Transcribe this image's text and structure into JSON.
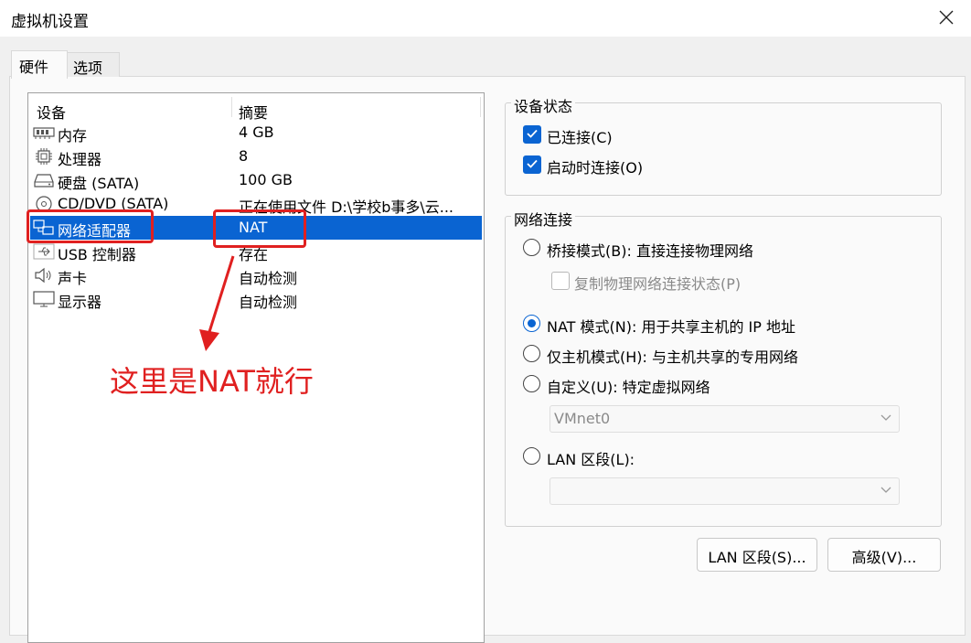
{
  "window": {
    "title": "虚拟机设置"
  },
  "tabs": [
    {
      "label": "硬件"
    },
    {
      "label": "选项"
    }
  ],
  "device_list": {
    "columns": {
      "device": "设备",
      "summary": "摘要"
    },
    "rows": [
      {
        "name": "内存",
        "summary": "4 GB",
        "icon": "memory-icon"
      },
      {
        "name": "处理器",
        "summary": "8",
        "icon": "processor-icon"
      },
      {
        "name": "硬盘 (SATA)",
        "summary": "100 GB",
        "icon": "harddisk-icon"
      },
      {
        "name": "CD/DVD (SATA)",
        "summary": "正在使用文件 D:\\学校b事多\\云...",
        "icon": "cd-dvd-icon"
      },
      {
        "name": "网络适配器",
        "summary": "NAT",
        "icon": "network-adapter-icon",
        "selected": true
      },
      {
        "name": "USB 控制器",
        "summary": "存在",
        "icon": "usb-icon"
      },
      {
        "name": "声卡",
        "summary": "自动检测",
        "icon": "speaker-icon"
      },
      {
        "name": "显示器",
        "summary": "自动检测",
        "icon": "monitor-icon"
      }
    ]
  },
  "annotation": {
    "text": "这里是NAT就行",
    "color": "#e02020"
  },
  "device_status": {
    "title": "设备状态",
    "connected": {
      "label": "已连接(C)",
      "checked": true
    },
    "connect_at_power_on": {
      "label": "启动时连接(O)",
      "checked": true
    }
  },
  "network_connection": {
    "title": "网络连接",
    "bridged": {
      "label": "桥接模式(B): 直接连接物理网络",
      "selected": false
    },
    "replicate": {
      "label": "复制物理网络连接状态(P)",
      "checked": false,
      "disabled": true
    },
    "nat": {
      "label": "NAT 模式(N): 用于共享主机的 IP 地址",
      "selected": true
    },
    "host_only": {
      "label": "仅主机模式(H): 与主机共享的专用网络",
      "selected": false
    },
    "custom": {
      "label": "自定义(U): 特定虚拟网络",
      "selected": false
    },
    "custom_select": {
      "value": "VMnet0"
    },
    "lan_segment": {
      "label": "LAN 区段(L):",
      "selected": false
    },
    "lan_select": {
      "value": ""
    }
  },
  "buttons": {
    "lan_segments": "LAN 区段(S)...",
    "advanced": "高级(V)..."
  },
  "colors": {
    "accent": "#0a64d2",
    "annotation_red": "#e02020"
  }
}
